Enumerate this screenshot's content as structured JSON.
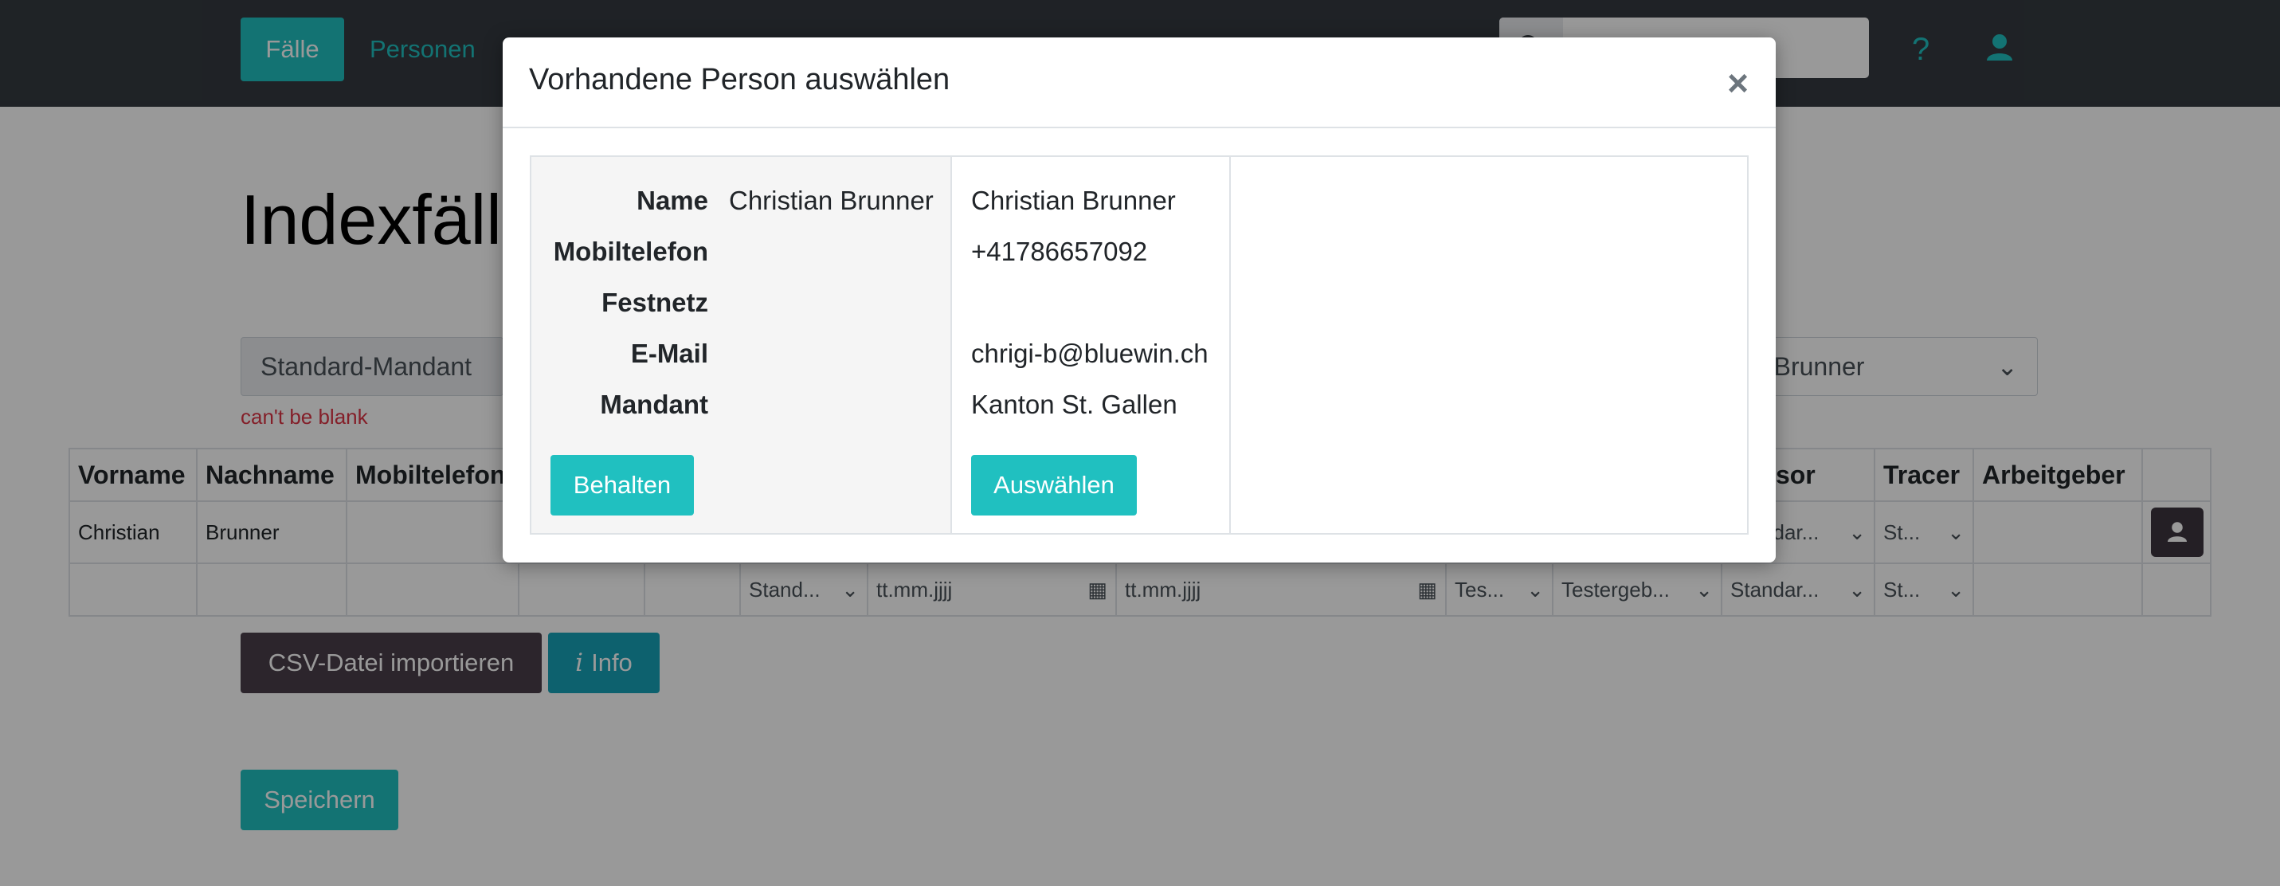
{
  "navbar": {
    "active_tab": "Fälle",
    "link_persons": "Personen",
    "help_label": "?",
    "icons": [
      "search-icon",
      "user-icon"
    ]
  },
  "page": {
    "title_visible": "Indexfälle",
    "mandant_select": "Standard-Mandant",
    "user_select_partial": "ian Brunner",
    "error_text": "can't be blank"
  },
  "table": {
    "headers": [
      "Vorname",
      "Nachname",
      "Mobiltelefon",
      "",
      "",
      "",
      "",
      "",
      "",
      "",
      "ervisor",
      "Tracer",
      "Arbeitgeber",
      ""
    ],
    "row1": {
      "firstname": "Christian",
      "lastname": "Brunner",
      "supervisor": "Standar...",
      "tracer": "St..."
    },
    "row2": {
      "mandant": "Stand...",
      "date1": "tt.mm.jjjj",
      "date2": "tt.mm.jjjj",
      "test": "Tes...",
      "result": "Testergeb...",
      "supervisor": "Standar...",
      "tracer": "St..."
    }
  },
  "buttons": {
    "csv_import": "CSV-Datei importieren",
    "info": "Info",
    "save": "Speichern"
  },
  "modal": {
    "title": "Vorhandene Person auswählen",
    "close": "×",
    "labels": [
      "Name",
      "Mobiltelefon",
      "Festnetz",
      "E-Mail",
      "Mandant"
    ],
    "current": {
      "name": "Christian Brunner"
    },
    "existing": {
      "name": "Christian Brunner",
      "mobile": "+41786657092",
      "email": "chrigi-b@bluewin.ch",
      "mandant": "Kanton St. Gallen"
    },
    "keep_button": "Behalten",
    "choose_button": "Auswählen"
  },
  "colors": {
    "accent": "#20c0c0",
    "navbar": "#343a40",
    "error": "#dc3545",
    "dark_button": "#4a3f4a",
    "info_button": "#17a2b8"
  }
}
